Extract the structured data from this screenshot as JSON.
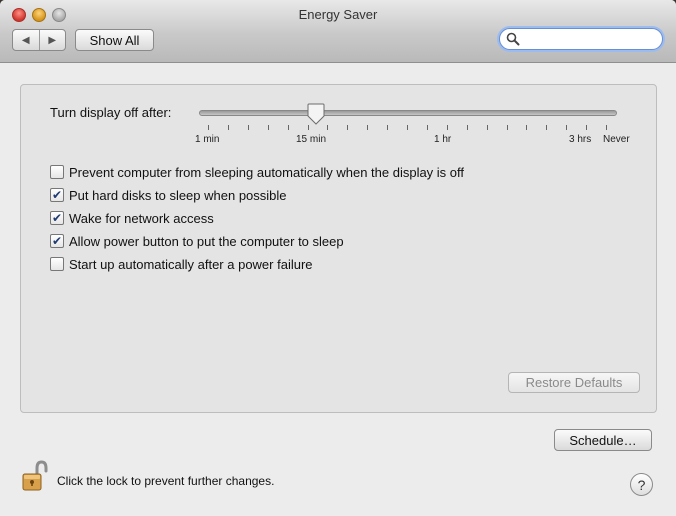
{
  "window": {
    "title": "Energy Saver"
  },
  "toolbar": {
    "back_glyph": "◀",
    "forward_glyph": "▶",
    "show_all_label": "Show All",
    "search_value": "",
    "search_placeholder": ""
  },
  "display_sleep": {
    "label": "Turn display off after:",
    "tick_labels": [
      "1 min",
      "15 min",
      "1 hr",
      "3 hrs",
      "Never"
    ],
    "selected": "15 min"
  },
  "options": [
    {
      "label": "Prevent computer from sleeping automatically when the display is off",
      "checked": false
    },
    {
      "label": "Put hard disks to sleep when possible",
      "checked": true
    },
    {
      "label": "Wake for network access",
      "checked": true
    },
    {
      "label": "Allow power button to put the computer to sleep",
      "checked": true
    },
    {
      "label": "Start up automatically after a power failure",
      "checked": false
    }
  ],
  "buttons": {
    "restore_defaults": "Restore Defaults",
    "schedule": "Schedule…",
    "help": "?"
  },
  "footer": {
    "lock_text": "Click the lock to prevent further changes."
  },
  "icons": {
    "search": "search-icon",
    "lock": "unlocked-padlock-icon",
    "help": "question-mark-icon"
  }
}
